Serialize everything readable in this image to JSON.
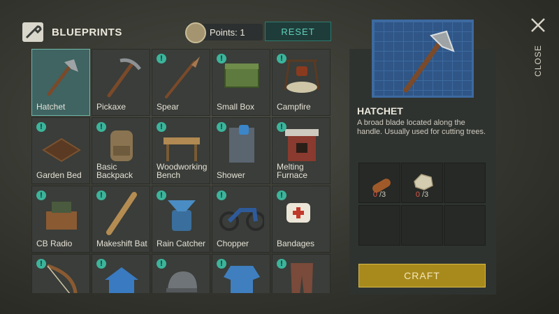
{
  "header": {
    "title": "BLUEPRINTS",
    "icon": "wrench-icon",
    "points_label": "Points: 1",
    "reset_label": "RESET"
  },
  "grid": [
    {
      "label": "Hatchet",
      "icon": "hatchet-icon",
      "selected": true,
      "locked": false
    },
    {
      "label": "Pickaxe",
      "icon": "pickaxe-icon",
      "locked": false
    },
    {
      "label": "Spear",
      "icon": "spear-icon",
      "locked": true
    },
    {
      "label": "Small Box",
      "icon": "box-icon",
      "locked": true
    },
    {
      "label": "Campfire",
      "icon": "campfire-icon",
      "locked": true
    },
    {
      "label": "Garden Bed",
      "icon": "garden-bed-icon",
      "locked": true
    },
    {
      "label": "Basic Backpack",
      "icon": "backpack-icon",
      "locked": true
    },
    {
      "label": "Woodworking Bench",
      "icon": "bench-icon",
      "locked": true
    },
    {
      "label": "Shower",
      "icon": "shower-icon",
      "locked": true
    },
    {
      "label": "Melting Furnace",
      "icon": "furnace-icon",
      "locked": true
    },
    {
      "label": "CB Radio",
      "icon": "radio-icon",
      "locked": true
    },
    {
      "label": "Makeshift Bat",
      "icon": "bat-icon",
      "locked": true
    },
    {
      "label": "Rain Catcher",
      "icon": "rain-catcher-icon",
      "locked": true
    },
    {
      "label": "Chopper",
      "icon": "motorcycle-icon",
      "locked": true
    },
    {
      "label": "Bandages",
      "icon": "bandage-icon",
      "locked": true
    },
    {
      "label": "",
      "icon": "bow-icon",
      "locked": true
    },
    {
      "label": "",
      "icon": "doghouse-icon",
      "locked": true
    },
    {
      "label": "",
      "icon": "cap-icon",
      "locked": true
    },
    {
      "label": "",
      "icon": "shirt-icon",
      "locked": true
    },
    {
      "label": "",
      "icon": "pants-icon",
      "locked": true
    }
  ],
  "detail": {
    "name": "HATCHET",
    "description": "A broad blade located along the handle. Usually used for cutting trees.",
    "image_icon": "hatchet-icon",
    "resources": [
      {
        "icon": "log-icon",
        "have": "0",
        "need": "/3"
      },
      {
        "icon": "stone-icon",
        "have": "0",
        "need": "/3"
      }
    ],
    "craft_label": "CRAFT"
  },
  "close_label": "CLOSE",
  "colors": {
    "accent": "#3cb49b",
    "craft": "#a88a1c",
    "blueprint": "#2f5686",
    "missing": "#e05a4a"
  }
}
